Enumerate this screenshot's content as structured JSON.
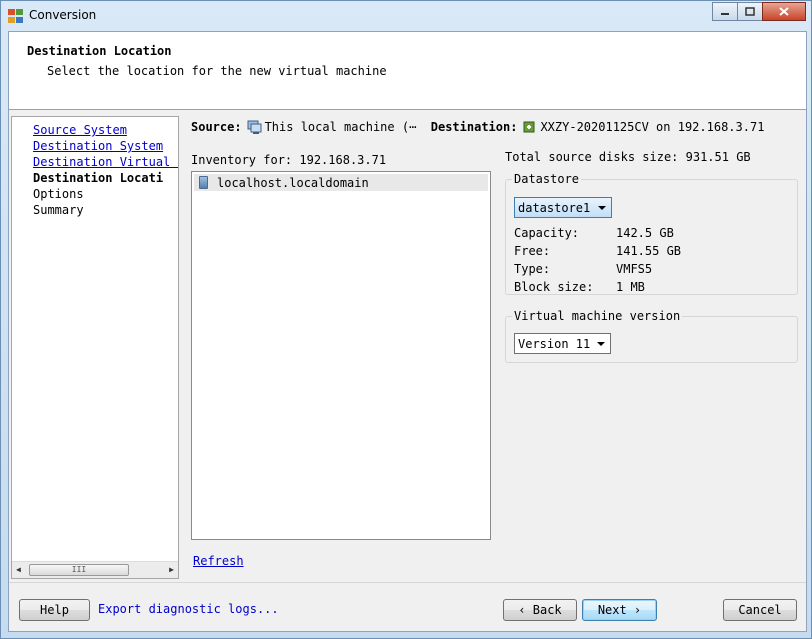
{
  "window": {
    "title": "Conversion"
  },
  "header": {
    "title": "Destination Location",
    "subtitle": "Select the location for the new virtual machine"
  },
  "nav": {
    "items": [
      {
        "label": "Source System",
        "state": "link"
      },
      {
        "label": "Destination System",
        "state": "link"
      },
      {
        "label": "Destination Virtual M",
        "state": "link"
      },
      {
        "label": "Destination Locati",
        "state": "current"
      },
      {
        "label": "Options",
        "state": "normal"
      },
      {
        "label": "Summary",
        "state": "normal"
      }
    ],
    "scroll_thumb": "III"
  },
  "source_line": {
    "source_label": "Source:",
    "source_value": "This local machine (⋯",
    "destination_label": "Destination:",
    "destination_value": "XXZY-20201125CV on 192.168.3.71"
  },
  "inventory": {
    "label": "Inventory for: 192.168.3.71",
    "items": [
      "localhost.localdomain"
    ],
    "refresh": "Refresh"
  },
  "total_disks": "Total source disks size: 931.51 GB",
  "datastore": {
    "legend": "Datastore",
    "selected": "datastore1",
    "rows": [
      {
        "label": "Capacity:",
        "value": "142.5 GB"
      },
      {
        "label": "Free:",
        "value": "141.55 GB"
      },
      {
        "label": "Type:",
        "value": "VMFS5"
      },
      {
        "label": "Block size:",
        "value": "1 MB"
      }
    ]
  },
  "vm_version": {
    "legend": "Virtual machine version",
    "selected": "Version 11"
  },
  "footer": {
    "help": "Help",
    "export": "Export diagnostic logs...",
    "back": "‹ Back",
    "next": "Next ›",
    "cancel": "Cancel"
  },
  "colors": {
    "link": "#0000cc",
    "focus_border": "#3c7fb1"
  }
}
